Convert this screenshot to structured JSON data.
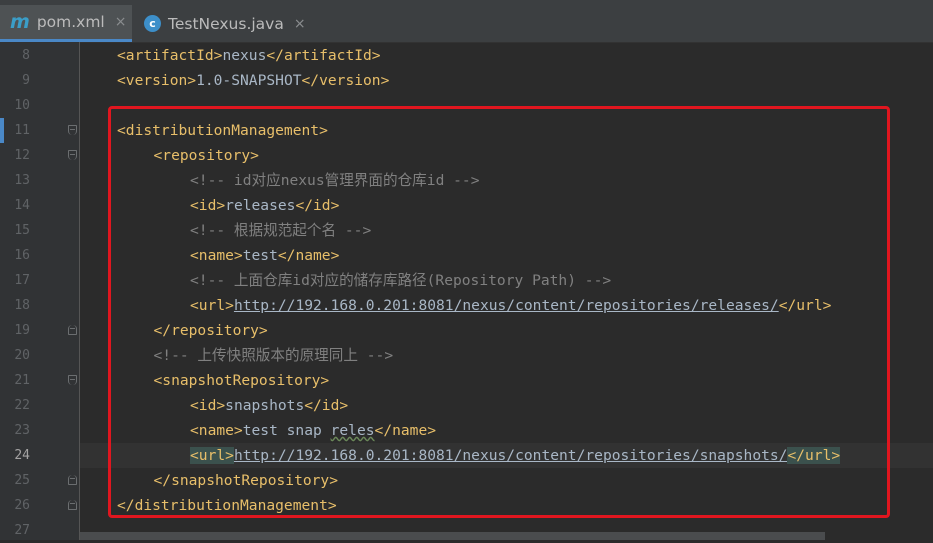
{
  "tabs": [
    {
      "label": "pom.xml",
      "icon": "maven-m-icon",
      "active": true
    },
    {
      "label": "TestNexus.java",
      "icon": "java-class-icon",
      "active": false
    }
  ],
  "close_glyph": "×",
  "tab_icons": {
    "maven": "m",
    "java": "c"
  },
  "lines": [
    {
      "n": "8",
      "ind": 1,
      "parts": [
        [
          "tag",
          "<artifactId>"
        ],
        [
          "txt",
          "nexus"
        ],
        [
          "tag",
          "</artifactId>"
        ]
      ]
    },
    {
      "n": "9",
      "ind": 1,
      "parts": [
        [
          "tag",
          "<version>"
        ],
        [
          "txt",
          "1.0-SNAPSHOT"
        ],
        [
          "tag",
          "</version>"
        ]
      ]
    },
    {
      "n": "10",
      "ind": 0,
      "parts": []
    },
    {
      "n": "11",
      "ind": 1,
      "fold": "open",
      "bookmark": true,
      "parts": [
        [
          "tag",
          "<distributionManagement>"
        ]
      ]
    },
    {
      "n": "12",
      "ind": 2,
      "fold": "open",
      "parts": [
        [
          "tag",
          "<repository>"
        ]
      ]
    },
    {
      "n": "13",
      "ind": 3,
      "parts": [
        [
          "cmt",
          "<!-- id对应nexus管理界面的仓库id -->"
        ]
      ]
    },
    {
      "n": "14",
      "ind": 3,
      "parts": [
        [
          "tag",
          "<id>"
        ],
        [
          "txt",
          "releases"
        ],
        [
          "tag",
          "</id>"
        ]
      ]
    },
    {
      "n": "15",
      "ind": 3,
      "parts": [
        [
          "cmt",
          "<!-- 根据规范起个名 -->"
        ]
      ]
    },
    {
      "n": "16",
      "ind": 3,
      "parts": [
        [
          "tag",
          "<name>"
        ],
        [
          "txt",
          "test"
        ],
        [
          "tag",
          "</name>"
        ]
      ]
    },
    {
      "n": "17",
      "ind": 3,
      "parts": [
        [
          "cmt",
          "<!-- 上面仓库id对应的储存库路径(Repository Path) -->"
        ]
      ]
    },
    {
      "n": "18",
      "ind": 3,
      "parts": [
        [
          "tag",
          "<url>"
        ],
        [
          "url",
          "http://192.168.0.201:8081/nexus/content/repositories/releases/"
        ],
        [
          "tag",
          "</url>"
        ]
      ]
    },
    {
      "n": "19",
      "ind": 2,
      "fold": "close",
      "parts": [
        [
          "tag",
          "</repository>"
        ]
      ]
    },
    {
      "n": "20",
      "ind": 2,
      "parts": [
        [
          "cmt",
          "<!-- 上传快照版本的原理同上 -->"
        ]
      ]
    },
    {
      "n": "21",
      "ind": 2,
      "fold": "open",
      "parts": [
        [
          "tag",
          "<snapshotRepository>"
        ]
      ]
    },
    {
      "n": "22",
      "ind": 3,
      "parts": [
        [
          "tag",
          "<id>"
        ],
        [
          "txt",
          "snapshots"
        ],
        [
          "tag",
          "</id>"
        ]
      ]
    },
    {
      "n": "23",
      "ind": 3,
      "parts": [
        [
          "tag",
          "<name>"
        ],
        [
          "txt",
          "test snap "
        ],
        [
          "squig",
          "reles"
        ],
        [
          "tag",
          "</name>"
        ]
      ]
    },
    {
      "n": "24",
      "ind": 3,
      "current": true,
      "parts": [
        [
          "hltag",
          "<url>"
        ],
        [
          "url",
          "http://192.168.0.201:8081/nexus/content/repositories/snapshots/"
        ],
        [
          "hltag",
          "</url>"
        ]
      ]
    },
    {
      "n": "25",
      "ind": 2,
      "fold": "close",
      "parts": [
        [
          "tag",
          "</snapshotRepository>"
        ]
      ]
    },
    {
      "n": "26",
      "ind": 1,
      "fold": "close",
      "parts": [
        [
          "tag",
          "</distributionManagement>"
        ]
      ]
    },
    {
      "n": "27",
      "ind": 0,
      "parts": []
    }
  ],
  "colors": {
    "background": "#2b2b2b",
    "gutter": "#313335",
    "tag": "#e8bf6a",
    "text": "#a9b7c6",
    "comment": "#808080",
    "highlight_box": "#e0161f",
    "active_tab_underline": "#4a88c7"
  }
}
